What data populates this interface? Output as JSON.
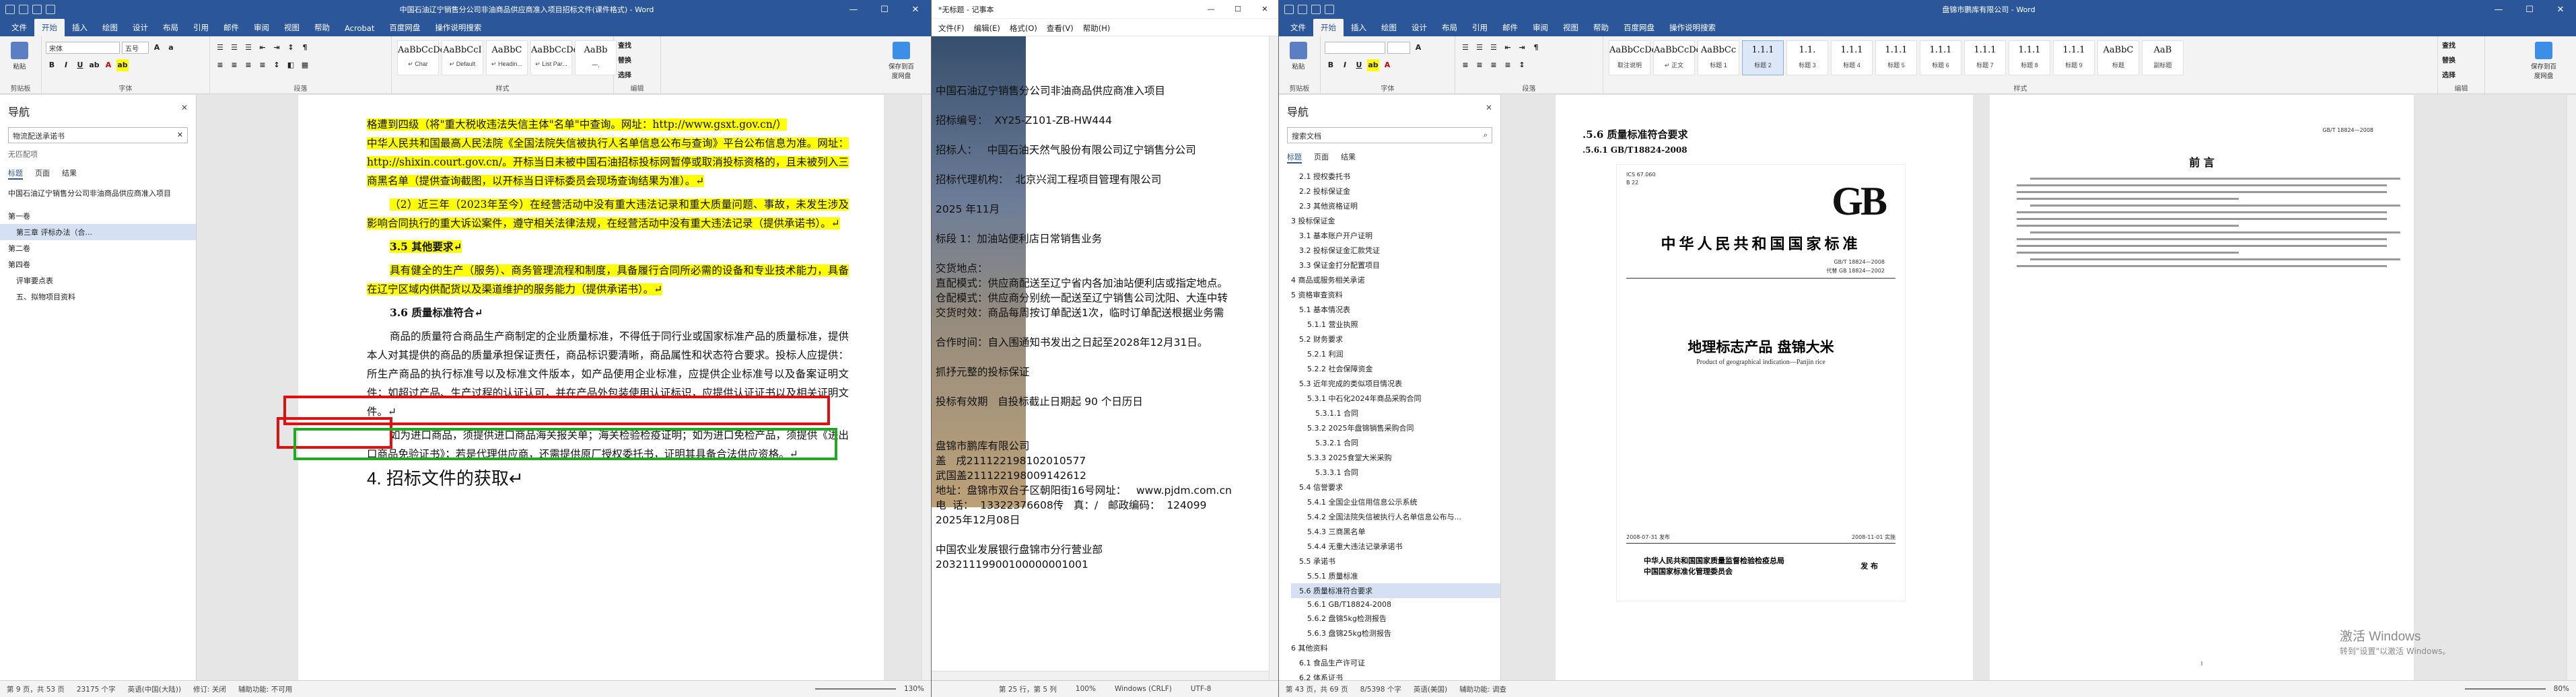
{
  "word1": {
    "title": "中国石油辽宁销售分公司非油商品供应商准入项目招标文件(课件格式) - Word",
    "tabs": [
      "文件",
      "开始",
      "插入",
      "绘图",
      "设计",
      "布局",
      "引用",
      "邮件",
      "审阅",
      "视图",
      "帮助",
      "Acrobat",
      "百度网盘",
      "操作说明搜索"
    ],
    "clipboard_label": "剪贴板",
    "font_label": "字体",
    "para_label": "段落",
    "styles_label": "样式",
    "edit_label": "编辑",
    "save_label": "保存到百度网盘",
    "paste": "粘贴",
    "font_name": "宋体",
    "font_size": "五号",
    "styles": [
      {
        "p": "AaBbCcDd",
        "n": "↵ Char"
      },
      {
        "p": "AaBbCcI",
        "n": "↵ Default"
      },
      {
        "p": "AaBbC",
        "n": "↵ Headin..."
      },
      {
        "p": "AaBbCcDd",
        "n": "↵ List Par..."
      },
      {
        "p": "AaBb",
        "n": "一."
      }
    ],
    "find": "查找",
    "replace": "替换",
    "select": "选择",
    "nav": {
      "title": "导航",
      "search": "物流配送承诺书",
      "no_match": "无匹配项",
      "tabs": [
        "标题",
        "页面",
        "结果"
      ],
      "items": [
        "中国石油辽宁销售分公司非油商品供应商准入项目",
        "第一卷",
        "第三章 评标办法（合...",
        "第二卷",
        "第四卷",
        "评审要点表",
        "五、拟物项目资料"
      ]
    },
    "paragraphs": [
      "格遭到四级（将\"重大税收违法失信主体\"名单\"中查询。网址：http://www.gsxt.gov.cn/）",
      "中华人民共和国最高人民法院《全国法院失信被执行人名单信息公布与查询》平台公布信息为准。网址：http://shixin.court.gov.cn/。开标当日未被中国石油招标投标网暂停或取消投标资格的，且未被列入三商黑名单（提供查询截图，以开标当日评标委员会现场查询结果为准）。↵",
      "（2）近三年（2023年至今）在经营活动中没有重大违法记录和重大质量问题、事故，未发生涉及影响合同执行的重大诉讼案件，遵守相关法律法规，在经营活动中没有重大违法记录（提供承诺书）。↵",
      "3.5 其他要求↵",
      "具有健全的生产（服务）、商务管理流程和制度，具备履行合同所必需的设备和专业技术能力，具备在辽宁区域内供配货以及渠道维护的服务能力（提供承诺书）。↵",
      "3.6 质量标准符合↵",
      "商品的质量符合商品生产商制定的企业质量标准，不得低于同行业或国家标准产品的质量标准，提供本人对其提供的商品的质量承担保证责任，商品标识要清晰，商品属性和状态符合要求。投标人应提供：所生产商品的执行标准号以及标准文件版本，如产品使用企业标准，应提供企业标准号以及备案证明文件；如超过产品、生产过程的认证认可，并在产品外包装使用认证标识，应提供认证证书以及相关证明文件。↵",
      "如为进口商品，须提供进口商品海关报关单；海关检验检疫证明；如为进口免检产品，须提供《进出口商品免验证书》；若是代理供应商，还需提供原厂授权委托书，证明其具备合法供应资格。↵",
      "4. 招标文件的获取↵"
    ],
    "status": {
      "page": "第 9 页，共 53 页",
      "words": "23175 个字",
      "lang": "英语(中国(大陆))",
      "track": "修订: 关闭",
      "access": "辅助功能: 不可用",
      "zoom": "130%"
    }
  },
  "notepad": {
    "title": "*无标题 - 记事本",
    "menu": [
      "文件(F)",
      "编辑(E)",
      "格式(O)",
      "查看(V)",
      "帮助(H)"
    ],
    "lines": [
      "中国石油辽宁销售分公司非油商品供应商准入项目",
      "",
      "招标编号：  XY25-Z101-ZB-HW444",
      "",
      "招标人：   中国石油天然气股份有限公司辽宁销售分公司",
      "",
      "招标代理机构：  北京兴润工程项目管理有限公司",
      "",
      "2025 年11月",
      "",
      "标段 1：加油站便利店日常销售业务",
      "",
      "交货地点：",
      "直配模式：供应商配送至辽宁省内各加油站便利店或指定地点。",
      "仓配模式：供应商分别统一配送至辽宁销售公司沈阳、大连中转",
      "交货时效：商品每周按订单配送1次，临时订单配送根据业务需",
      "",
      "合作时间：自入围通知书发出之日起至2028年12月31日。",
      "",
      "抓抒元整的投标保证",
      "",
      "投标有效期   自投标截止日期起 90 个日历日",
      "",
      "",
      "盘锦市鹏库有限公司",
      "盖   戌211122198102010577",
      "武国盖211122198009142612",
      "地址：盘锦市双台子区朝阳街16号网址：   www.pjdm.com.cn",
      "电  话：  13322376608传   真：/   邮政编码：  124099",
      "2025年12月08日",
      "",
      "中国农业发展银行盘锦市分行营业部",
      "20321119900100000001001"
    ],
    "status": {
      "pos": "第 25 行，第 5 列",
      "zoom": "100%",
      "eol": "Windows (CRLF)",
      "enc": "UTF-8"
    }
  },
  "word2": {
    "title": "盘锦市鹏库有限公司 - Word",
    "tabs": [
      "文件",
      "开始",
      "插入",
      "绘图",
      "设计",
      "布局",
      "引用",
      "邮件",
      "审阅",
      "视图",
      "帮助",
      "百度网盘",
      "操作说明搜索"
    ],
    "styles": [
      {
        "p": "AaBbCcDd",
        "n": "取注说明"
      },
      {
        "p": "AaBbCcDd",
        "n": "↵ 正文"
      },
      {
        "p": "AaBbCc",
        "n": "标题 1"
      },
      {
        "p": "1.1.1",
        "n": "标题 2"
      },
      {
        "p": "1.1.",
        "n": "标题 3"
      },
      {
        "p": "1.1.1",
        "n": "标题 4"
      },
      {
        "p": "1.1.1",
        "n": "标题 5"
      },
      {
        "p": "1.1.1",
        "n": "标题 6"
      },
      {
        "p": "1.1.1",
        "n": "标题 7"
      },
      {
        "p": "1.1.1",
        "n": "标题 8"
      },
      {
        "p": "1.1.1",
        "n": "标题 9"
      },
      {
        "p": "AaBbC",
        "n": "标题"
      },
      {
        "p": "AaB",
        "n": "副标题"
      }
    ],
    "nav": {
      "title": "导航",
      "search": "搜索文档",
      "tabs": [
        "标题",
        "页面",
        "结果"
      ],
      "items": [
        "2.1 授权委托书",
        "2.2 投标保证金",
        "2.3 其他资格证明",
        "3 投标保证金",
        "3.1 基本账户开户证明",
        "3.2 投标保证金汇款凭证",
        "3.3 保证金打分配置项目",
        "4 商品或服务相关承诺",
        "5 资格审查资料",
        "5.1 基本情况表",
        "5.1.1 营业执照",
        "5.2 财务要求",
        "5.2.1 利润",
        "5.2.2 社会保障资金",
        "5.3 近年完成的类似项目情况表",
        "5.3.1 中石化2024年商品采购合同",
        "5.3.1.1 合同",
        "5.3.2 2025年盘锦销售采购合同",
        "5.3.2.1 合同",
        "5.3.3 2025食堂大米采购",
        "5.3.3.1 合同",
        "5.4 信誉要求",
        "5.4.1 全国企业信用信息公示系统",
        "5.4.2 全国法院失信被执行人名单信息公布与...",
        "5.4.3 三商黑名单",
        "5.4.4 无重大违法记录承诺书",
        "5.5 承诺书",
        "5.5.1 质量标准",
        "5.6 质量标准符合要求",
        "5.6.1 GB/T18824-2008",
        "5.6.2 盘锦5kg检测报告",
        "5.6.3 盘锦25kg检测报告",
        "6 其他资料",
        "6.1 食品生产许可证",
        "6.2 体系证书",
        "6.3 荣誉证书"
      ],
      "selected": 28
    },
    "page1": {
      "h1": ".5.6  质量标准符合要求",
      "h2": ".5.6.1 GB/T18824-2008",
      "ics": "ICS 67.060",
      "cls": "B 22",
      "logo": "GB",
      "cn": "中华人民共和国国家标准",
      "code": "GB/T 18824—2008",
      "code2": "代替 GB 18824—2002",
      "title": "地理标志产品  盘锦大米",
      "sub": "Product of geographical indication—Panjin rice",
      "pub": "2008-07-31 发布",
      "impl": "2008-11-01 实施",
      "org1": "中华人民共和国国家质量监督检验检疫总局",
      "org2": "中国国家标准化管理委员会",
      "pubw": "发 布"
    },
    "page2": {
      "code": "GB/T 18824—2008",
      "head": "前  言",
      "pg": "I"
    },
    "status": {
      "page": "第 43 页，共 69 页",
      "words": "8/5398 个字",
      "lang": "英语(美国)",
      "access": "辅助功能: 调查",
      "zoom": "80%"
    },
    "watermark": "激活 Windows",
    "watermark2": "转到\"设置\"以激活 Windows。"
  }
}
